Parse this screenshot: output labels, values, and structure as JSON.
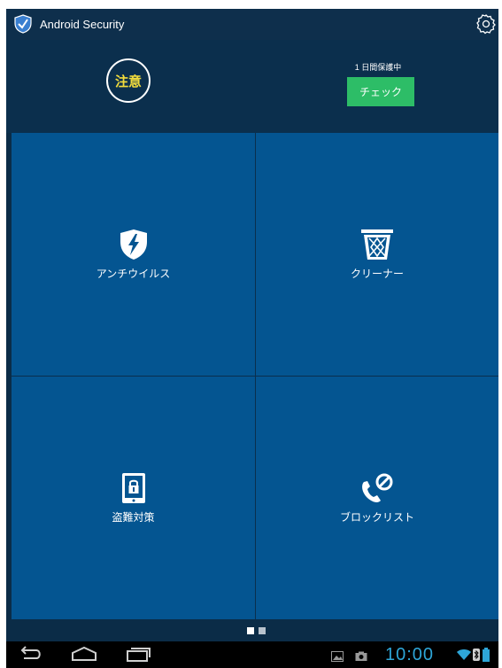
{
  "app": {
    "title": "Android Security"
  },
  "status": {
    "warning_label": "注意",
    "protection_text": "1 日間保護中",
    "check_button_label": "チェック"
  },
  "tiles": [
    {
      "label": "アンチウイルス",
      "icon": "shield-bolt-icon"
    },
    {
      "label": "クリーナー",
      "icon": "trash-bin-icon"
    },
    {
      "label": "盗難対策",
      "icon": "tablet-lock-icon"
    },
    {
      "label": "ブロックリスト",
      "icon": "phone-block-icon"
    }
  ],
  "pager": {
    "pages": 2,
    "current": 1
  },
  "system": {
    "time": "10:00"
  },
  "colors": {
    "tile": "#045591",
    "accent_green": "#2dbd67",
    "warning_text": "#f2dc3c",
    "clock": "#2ea6d8"
  }
}
